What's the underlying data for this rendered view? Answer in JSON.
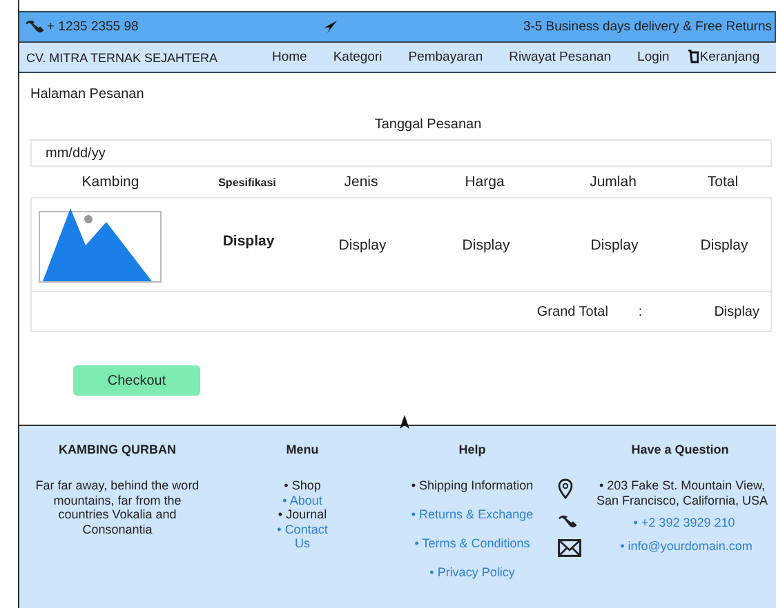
{
  "top_bar": {
    "phone": "+ 1235 2355 98",
    "notice": "3-5 Business days delivery & Free Returns"
  },
  "nav": {
    "brand": "CV. MITRA TERNAK SEJAHTERA",
    "items": [
      "Home",
      "Kategori",
      "Pembayaran",
      "Riwayat Pesanan",
      "Login"
    ],
    "cart": "Keranjang"
  },
  "page_title": "Halaman Pesanan",
  "date": {
    "label": "Tanggal Pesanan",
    "placeholder": "mm/dd/yy"
  },
  "table": {
    "columns": [
      "Kambing",
      "Spesifikasi",
      "Jenis",
      "Harga",
      "Jumlah",
      "Total"
    ],
    "rows": [
      {
        "spesifikasi": "Display",
        "jenis": "Display",
        "harga": "Display",
        "jumlah": "Display",
        "total": "Display"
      }
    ],
    "grand_total": {
      "label": "Grand Total",
      "separator": ":",
      "value": "Display"
    }
  },
  "checkout_button": "Checkout",
  "footer": {
    "about": {
      "title": "KAMBING QURBAN",
      "text": "Far far away, behind the word mountains, far from the countries Vokalia and Consonantia"
    },
    "menu": {
      "title": "Menu",
      "items": [
        {
          "bullet": "•",
          "label": "Shop",
          "link": false
        },
        {
          "bullet": "•",
          "label": "About",
          "link": true
        },
        {
          "bullet": "•",
          "label": "Journal",
          "link": false
        },
        {
          "bullet": "•",
          "label": "Contact Us",
          "link": true
        }
      ]
    },
    "help": {
      "title": "Help",
      "items": [
        {
          "bullet": "•",
          "label": "Shipping Information",
          "link": false
        },
        {
          "bullet": "•",
          "label": "Returns & Exchange",
          "link": true
        },
        {
          "bullet": "•",
          "label": "Terms & Conditions",
          "link": true
        },
        {
          "bullet": "•",
          "label": "Privacy Policy",
          "link": true
        }
      ]
    },
    "contact": {
      "title": "Have a Question",
      "items": [
        {
          "kind": "address",
          "bullet": "•",
          "label": "203 Fake St. Mountain View, San Francisco, California, USA",
          "link": false
        },
        {
          "kind": "phone",
          "bullet": "•",
          "label": "+2 392 3929 210",
          "link": true
        },
        {
          "kind": "email",
          "bullet": "•",
          "label": "info@yourdomain.com",
          "link": true
        }
      ]
    }
  }
}
